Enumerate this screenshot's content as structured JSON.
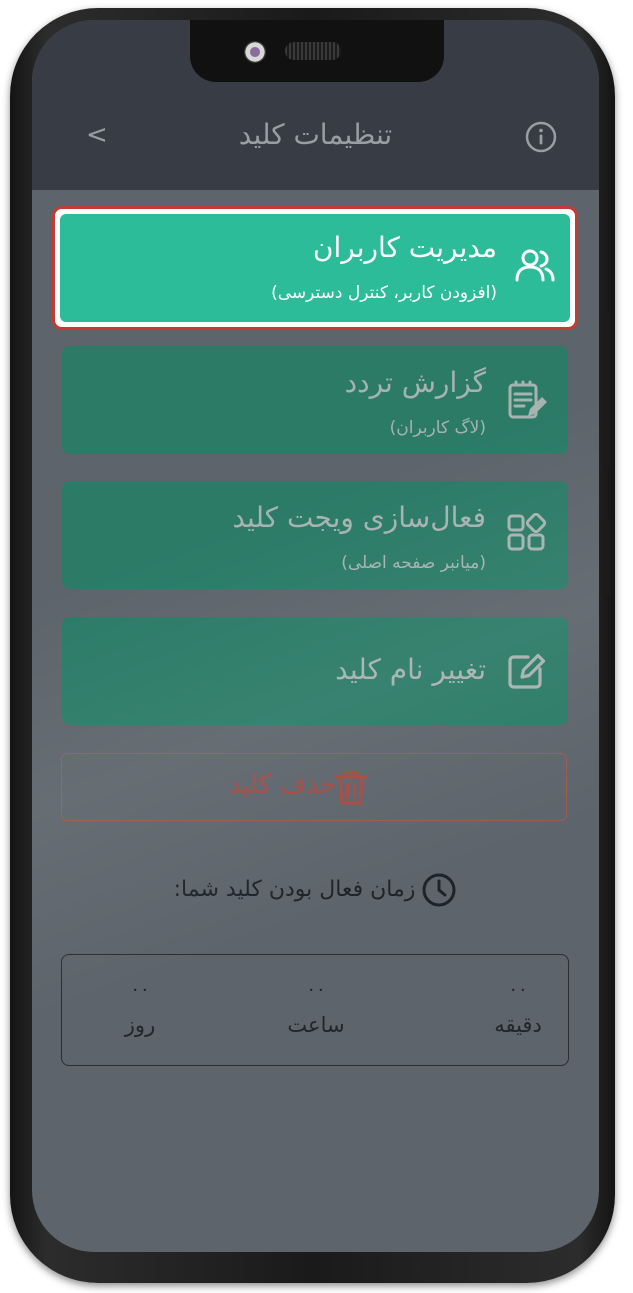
{
  "header": {
    "title": "تنظیمات کلید",
    "back_label": "<"
  },
  "menu": [
    {
      "title": "مدیریت کاربران",
      "subtitle": "(افزودن کاربر، کنترل دسترسی)",
      "icon": "users-icon"
    },
    {
      "title": "گزارش تردد",
      "subtitle": "(لاگ کاربران)",
      "icon": "clipboard-edit-icon"
    },
    {
      "title": "فعال‌سازی ویجت کلید",
      "subtitle": "(میانبر صفحه اصلی)",
      "icon": "widgets-icon"
    },
    {
      "title": "تغییر نام کلید",
      "subtitle": "",
      "icon": "edit-icon"
    }
  ],
  "delete": {
    "label": "حذف کلید",
    "icon": "trash-icon"
  },
  "active_time": {
    "label": "زمان فعال بودن کلید شما:",
    "icon": "clock-icon"
  },
  "timer": [
    {
      "value": "۰۰",
      "label": "دقیقه"
    },
    {
      "value": "۰۰",
      "label": "ساعت"
    },
    {
      "value": "۰۰",
      "label": "روز"
    }
  ],
  "colors": {
    "accent": "#2dbc9a",
    "highlight_border": "#c33b33",
    "danger": "#a74a40"
  }
}
